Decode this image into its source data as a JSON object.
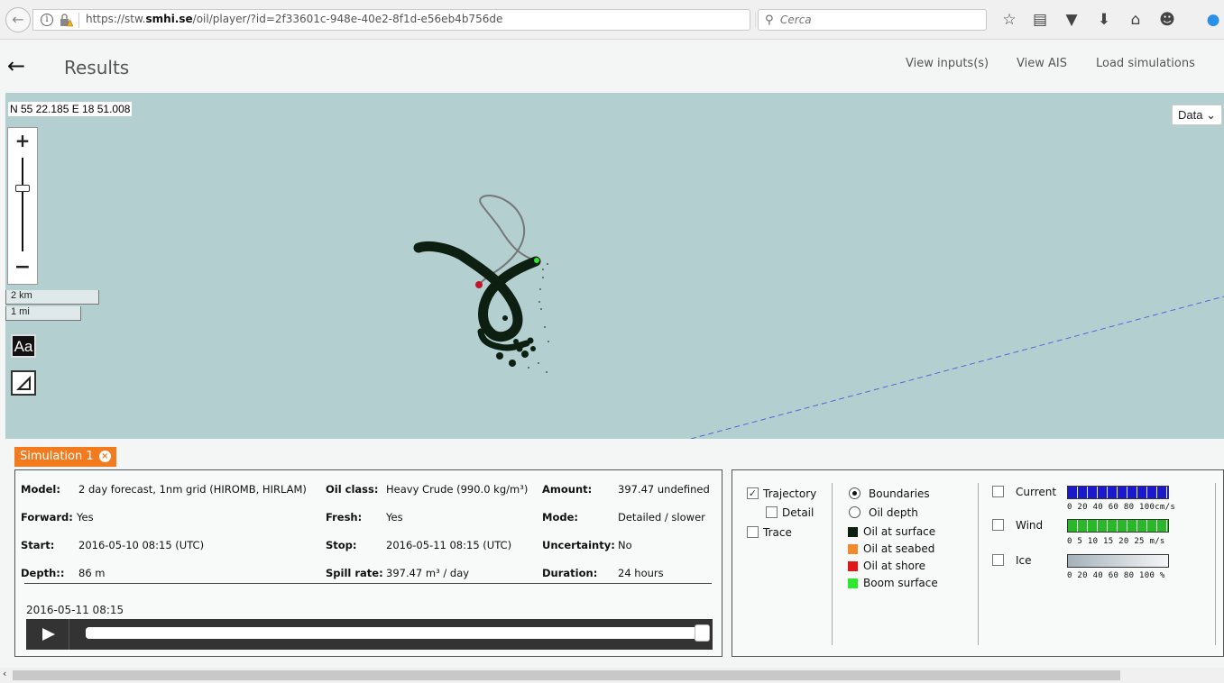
{
  "browser": {
    "url_prefix": "https://stw.",
    "url_domain": "smhi.se",
    "url_path": "/oil/player/?id=2f33601c-948e-40e2-8f1d-e56eb4b756de",
    "search_placeholder": "Cerca",
    "icons": [
      "bookmark-star-icon",
      "reading-list-icon",
      "pocket-icon",
      "download-icon",
      "home-icon",
      "chat-icon"
    ]
  },
  "header": {
    "title": "Results",
    "links": [
      "View inputs(s)",
      "View AIS",
      "Load simulations"
    ]
  },
  "map": {
    "coordinates": "N 55 22.185 E 18 51.008",
    "layer_select": "Data",
    "scale_km": "2 km",
    "scale_mi": "1 mi",
    "text_button": "Aa"
  },
  "simulation": {
    "tab_label": "Simulation 1",
    "fields": {
      "model_label": "Model:",
      "model_value": "2 day forecast, 1nm grid (HIROMB, HIRLAM)",
      "oil_class_label": "Oil class:",
      "oil_class_value": "Heavy Crude (990.0 kg/m³)",
      "amount_label": "Amount:",
      "amount_value": "397.47 undefined",
      "forward_label": "Forward:",
      "forward_value": "Yes",
      "fresh_label": "Fresh:",
      "fresh_value": "Yes",
      "mode_label": "Mode:",
      "mode_value": "Detailed / slower",
      "start_label": "Start:",
      "start_value": "2016-05-10 08:15 (UTC)",
      "stop_label": "Stop:",
      "stop_value": "2016-05-11 08:15 (UTC)",
      "uncertainty_label": "Uncertainty:",
      "uncertainty_value": "No",
      "depth_label": "Depth::",
      "depth_value": "86 m",
      "spill_rate_label": "Spill rate:",
      "spill_rate_value": "397.47 m³ / day",
      "duration_label": "Duration:",
      "duration_value": "24 hours"
    },
    "player": {
      "timestamp": "2016-05-11 08:15",
      "progress_fraction": 1.0
    }
  },
  "legend": {
    "trajectory_label": "Trajectory",
    "trajectory_checked": true,
    "detail_label": "Detail",
    "trace_label": "Trace",
    "boundaries_label": "Boundaries",
    "oil_depth_label": "Oil depth",
    "items": [
      {
        "label": "Oil at surface",
        "color": "#0d1f10"
      },
      {
        "label": "Oil at seabed",
        "color": "#f08a2c"
      },
      {
        "label": "Oil at shore",
        "color": "#e01818"
      },
      {
        "label": "Boom surface",
        "color": "#2ee82e"
      }
    ],
    "current_label": "Current",
    "current_ticks": "0  20  40  60  80  100cm/s",
    "current_color": "#1a1acc",
    "wind_label": "Wind",
    "wind_ticks": "0   5   10  15  20  25  m/s",
    "wind_color": "#2ab82a",
    "ice_label": "Ice",
    "ice_ticks": "0  20  40  60  80  100 %"
  }
}
